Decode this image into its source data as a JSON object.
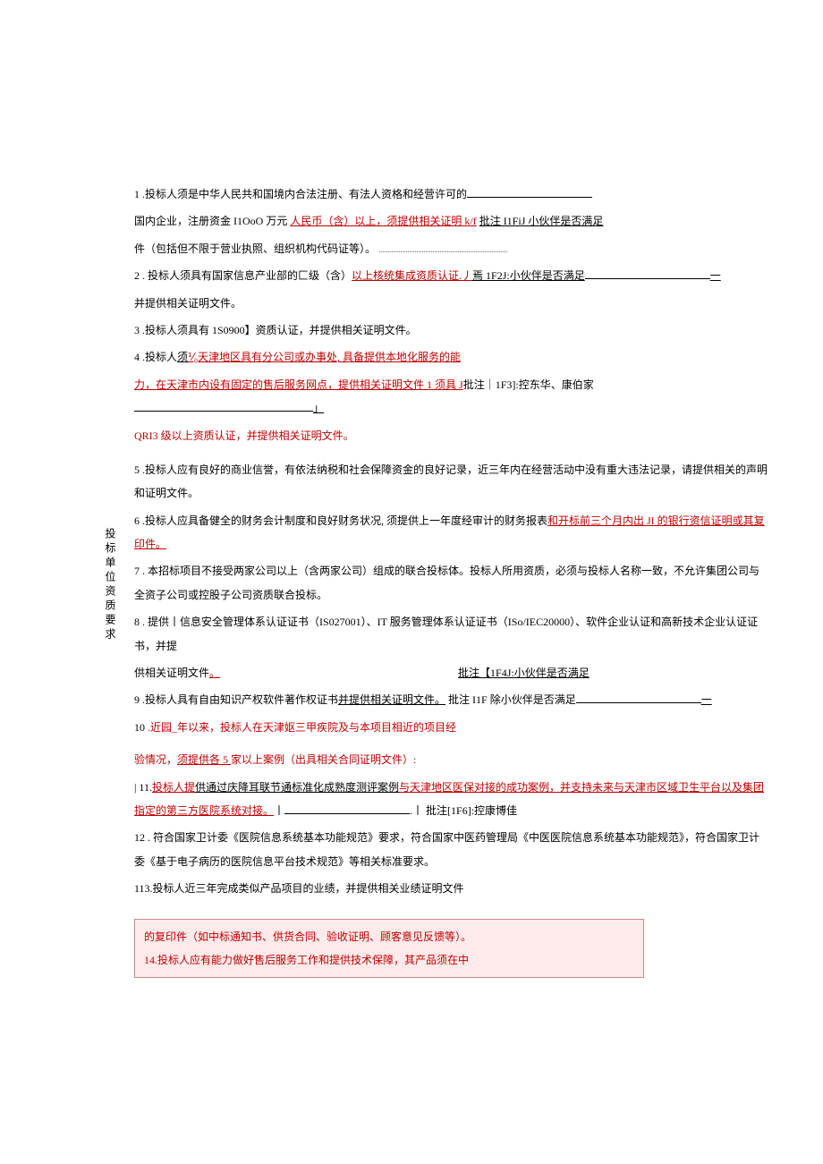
{
  "sideLabel": "投标单位资质要求",
  "items": {
    "i1": "1 .投标人须是中华人民共和国境内合法注册、有法人资格和经营许可的",
    "i1b_a": "国内企业，注册资金 I1OoO 万元",
    "i1b_b": "人民币（含）以上，须提供相关证明 k/f",
    "i1b_c": "批注 I1FiJ 小伙伴是否满足",
    "i1c": "件（包括但不限于营业执照、组织机构代码证等）。",
    "gray1": "........................................................................",
    "i2a": "2 . 投标人须具有国家信息产业部的匚级（含）",
    "i2b": "以上核统集成资质认证.丿",
    "i2c": "焉 1F2J:小伙伴是否满足",
    "i2d": "一",
    "i2e": "并提供相关证明文件。",
    "i3": "3 .投标人须具有 1S0900】资质认证，并提供相关证明文件。",
    "i4a": "4 .投标人",
    "i4b": "须",
    "i4c": "⅟₀天津地区具有分公司或办事处, 具备提供本地化服务的能",
    "i4d": "力，在天津市内设有固定的售后服务网点，提供相关证明文件 1 须具 J",
    "i4e": "批注｜1F3]:控东华、康伯家",
    "i4e2": "」",
    "i4f": "QRI3 级以上资质认证，",
    "i4g": "并提供相关证明文件。",
    "i5": "5 .投标人应有良好的商业信誉，有依法纳税和社会保障资金的良好记录，近三年内在经营活动中没有重大违法记录，请提供相关的声明和证明文件。",
    "i6a": "6 .投标人应具备健全的财务会计制度和良好财务状况, 须提供上一年度经审计的财务报表",
    "i6b": "和开标前三个月内出 JI 的银行资信证明或其复印件。",
    "i7": "7 . 本招标项目不接受两家公司以上（含两家公司）组成的联合投标体。投标人所用资质，必须与投标人名称一致，不允许集团公司与全资子公司或控股子公司资质联合投标。",
    "i8a": "8 . 提供丨信息安全管理体系认证证书（IS027001）、IT 服务管理体系认证证书（ISo/IEC20000）、软件企业认证和高新技术企业认证证书，并提",
    "i8b": "供相关证明文件",
    "i8c": "。",
    "i8d": "批注【1F4J:小伙伴是否满足",
    "i9a": "9 .投标人具有自由知识产权软件著作权证书",
    "i9b": "并提供相关证明文件。",
    "i9c": "批注 I1F 除小伙伴是否满足",
    "i9d": "一",
    "i10a": "10 ",
    "i10b": ".近园_年以来，投标人在天津妪三甲疾院及与本项目相近的项目经",
    "i10c": "验情况，",
    "i10d": "须提供各 5 ",
    "i10e": "家以上案例（出具相关合同证明文件）:",
    "i11a": "| 11.",
    "i11b": "投标人提",
    "i11c": "供通过庆降耳联节通标准化成熟度测评案例",
    "i11d": "与天津地区医保对接的成功案例，并支持未来与天津市区域卫生平台以及集团指定的第三方医院系统对接。",
    "i11e": "丨",
    "i11f": ".丨",
    "i11g": "批注[1F6]:控康博佳",
    "i12": "12 . 符合国家卫计委《医院信息系统基本功能规范》要求，符合国家中医药管理局《中医医院信息系统基本功能规范》，符合国家卫计委《基于电子病历的医院信息平台技术规范》等相关标准要求。",
    "i13": "113.投标人近三年完成类似产品项目的业绩，并提供相关业绩证明文件"
  },
  "box": {
    "l1": "的复印件（如中标通知书、供货合同、验收证明、顾客意见反馈等）。",
    "l2": "14.投标人应有能力做好售后服务工作和提供技术保障，其产品须在中"
  }
}
